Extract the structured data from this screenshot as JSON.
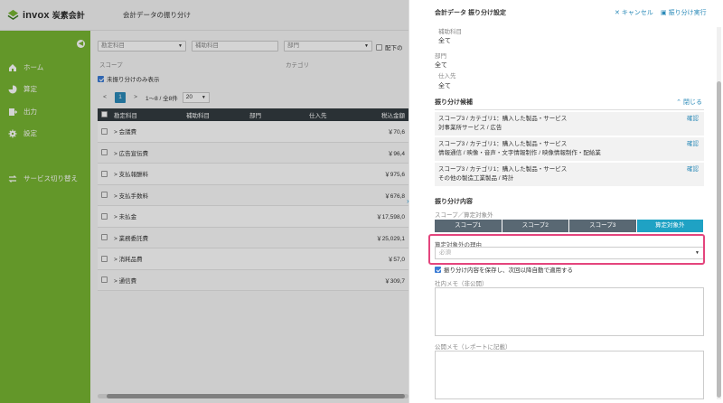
{
  "app": {
    "brand": "invox",
    "brand_sub": "炭素会計",
    "page_title": "会計データの振り分け"
  },
  "sidebar": {
    "items": [
      {
        "label": "ホーム",
        "icon": "home-icon"
      },
      {
        "label": "算定",
        "icon": "pie-chart-icon"
      },
      {
        "label": "出力",
        "icon": "export-icon"
      },
      {
        "label": "設定",
        "icon": "gear-icon"
      },
      {
        "label": "サービス切り替え",
        "icon": "switch-icon"
      }
    ]
  },
  "filters": {
    "account_placeholder": "勘定科目",
    "sub_account_placeholder": "補助科目",
    "department_placeholder": "部門",
    "scope_label": "スコープ",
    "category_label": "カテゴリ",
    "allocated_label": "配下の",
    "unassigned_only_label": "未振り分けのみ表示"
  },
  "pager": {
    "prev": "<",
    "current": "1",
    "next": ">",
    "range": "1〜8 / 全8件",
    "per_page": "20"
  },
  "table": {
    "headers": [
      "勘定科目",
      "補助科目",
      "部門",
      "仕入先",
      "税込金額"
    ],
    "rows": [
      {
        "account": "会議費",
        "amount": "￥70,6"
      },
      {
        "account": "広告宣伝費",
        "amount": "￥96,4"
      },
      {
        "account": "支払報酬料",
        "amount": "￥975,6"
      },
      {
        "account": "支払手数料",
        "amount": "￥676,8"
      },
      {
        "account": "未払金",
        "amount": "￥17,598,0"
      },
      {
        "account": "業務委託費",
        "amount": "￥25,029,1"
      },
      {
        "account": "消耗品費",
        "amount": "￥57,0"
      },
      {
        "account": "通信費",
        "amount": "￥309,7"
      }
    ]
  },
  "panel": {
    "title": "会計データ 振り分け設定",
    "cancel": "キャンセル",
    "execute": "振り分け実行",
    "sub_account_label": "補助科目",
    "sub_account_value": "全て",
    "department_label": "部門",
    "department_value": "全て",
    "supplier_label": "仕入先",
    "supplier_value": "全て",
    "candidates_title": "振り分け候補",
    "candidates_close": "閉じる",
    "candidates": [
      {
        "line1": "スコープ3 / カテゴリ1：購入した製品・サービス",
        "line2": "対事業所サービス / 広告",
        "action": "確認"
      },
      {
        "line1": "スコープ3 / カテゴリ1：購入した製品・サービス",
        "line2": "情報通信 / 映像・音声・文字情報制作 / 映像情報制作・配給業",
        "action": "確認"
      },
      {
        "line1": "スコープ3 / カテゴリ1：購入した製品・サービス",
        "line2": "その他の製造工業製品 / 時計",
        "action": "確認"
      }
    ],
    "split_title": "振り分け内容",
    "split_sub": "スコープ／算定対象外",
    "segments": [
      "スコープ1",
      "スコープ2",
      "スコープ3",
      "算定対象外"
    ],
    "reason_label": "算定対象外の理由",
    "reason_placeholder": "必須",
    "save_label": "振り分け内容を保存し、次回以降自動で適用する",
    "memo_internal_label": "社内メモ（非公開）",
    "memo_public_label": "公開メモ（レポートに記載）"
  },
  "colors": {
    "sidebar": "#78b632",
    "accent": "#2b8ab8",
    "active_segment": "#1fa2c4",
    "highlight": "#e4457d"
  }
}
